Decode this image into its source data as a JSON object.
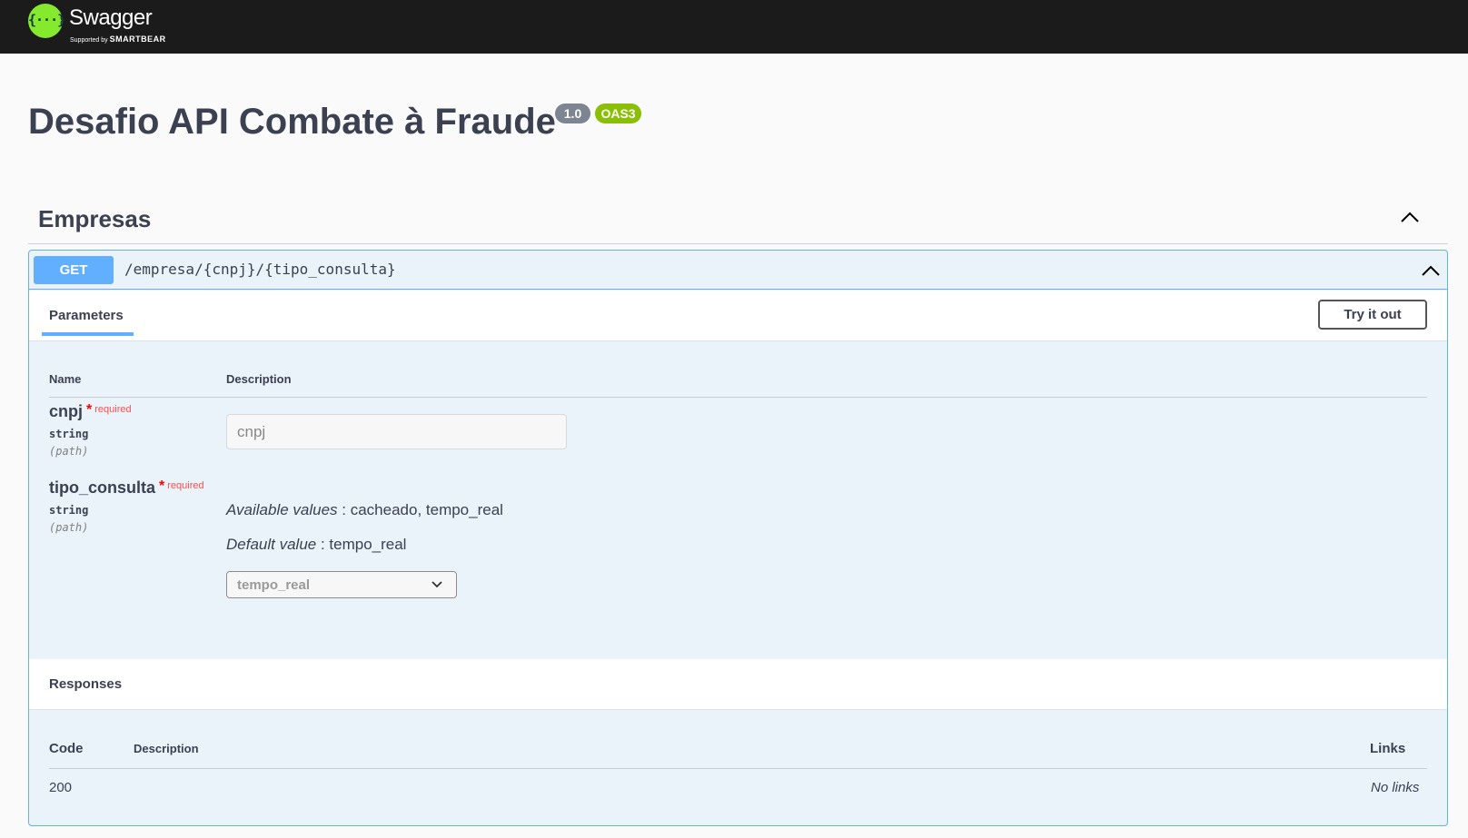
{
  "topbar": {
    "logo_glyph": "{···}",
    "logo_title": "Swagger",
    "logo_sub_prefix": "Supported by ",
    "logo_sub_brand": "SMARTBEAR"
  },
  "info": {
    "title": "Desafio API Combate à Fraude",
    "version": "1.0",
    "oas": "OAS3"
  },
  "tag": {
    "name": "Empresas",
    "expanded": true
  },
  "operation": {
    "method": "GET",
    "path": "/empresa/{cnpj}/{tipo_consulta}",
    "tab_parameters": "Parameters",
    "try_button": "Try it out",
    "table_headers": {
      "name": "Name",
      "description": "Description"
    },
    "required_label": "required",
    "params": [
      {
        "name": "cnpj",
        "type": "string",
        "in": "(path)",
        "placeholder": "cnpj",
        "value": ""
      },
      {
        "name": "tipo_consulta",
        "type": "string",
        "in": "(path)",
        "available_label": "Available values",
        "available_values": " : cacheado, tempo_real",
        "default_label": "Default value",
        "default_value": " : tempo_real",
        "selected": "tempo_real"
      }
    ],
    "responses": {
      "title": "Responses",
      "headers": {
        "code": "Code",
        "description": "Description",
        "links": "Links"
      },
      "rows": [
        {
          "code": "200",
          "description": "",
          "links": "No links"
        }
      ]
    }
  },
  "colors": {
    "get_method": "#61affe",
    "topbar": "#1b1b1b",
    "logo_green": "#85ea2d",
    "version_badge": "#7d8492",
    "oas_badge": "#89bf04",
    "required": "#ff0000"
  },
  "icons": {
    "logo": "swagger-logo-icon",
    "tag_toggle": "chevron-up-icon",
    "op_toggle": "chevron-up-icon",
    "select_arrow": "chevron-down-icon"
  }
}
